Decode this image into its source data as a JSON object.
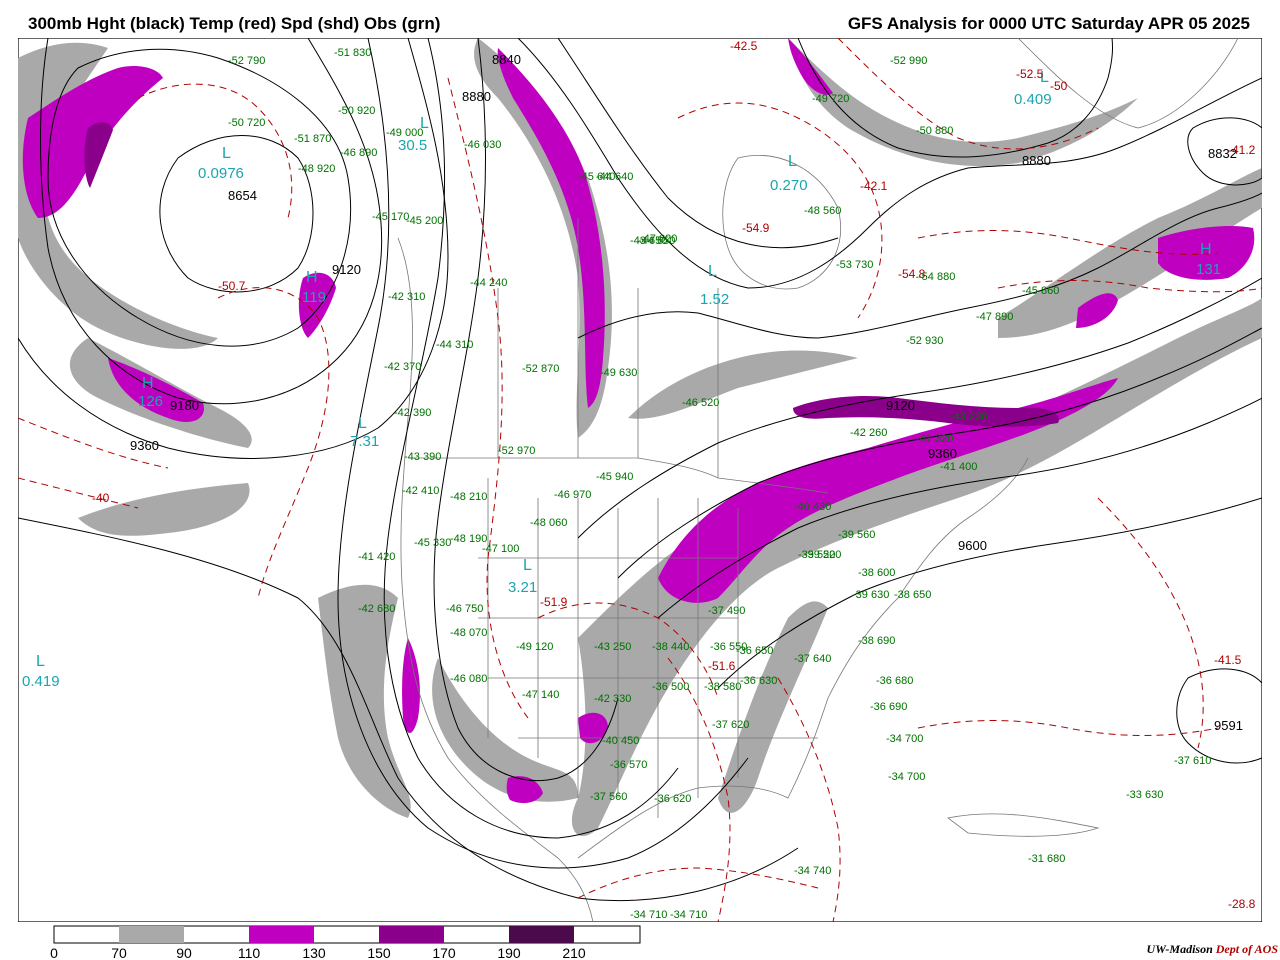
{
  "header": {
    "left_title": "300mb Hght (black) Temp (red) Spd (shd) Obs (grn)",
    "right_title": "GFS Analysis for 0000 UTC Saturday  APR 05 2025"
  },
  "colors": {
    "height_contour": "#000000",
    "temp_contour": "#b00000",
    "obs_text": "#007000",
    "label_cyan": "#1aa5b0",
    "speed_70_90": "#a9a9a9",
    "speed_110_130": "#c000c0",
    "speed_150_170": "#8b008b",
    "speed_190_210": "#4b0a4b"
  },
  "legend": {
    "ticks": [
      "0",
      "70",
      "90",
      "110",
      "130",
      "150",
      "170",
      "190",
      "210"
    ]
  },
  "credit": {
    "org": "UW-Madison",
    "dept": "Dept of AOS"
  },
  "map_labels": {
    "highs_lows": [
      {
        "text": "L",
        "kind": "low"
      },
      {
        "text": "0.0976",
        "kind": "val"
      },
      {
        "text": "L",
        "kind": "low"
      },
      {
        "text": "7.31",
        "kind": "val"
      },
      {
        "text": "L",
        "kind": "low"
      },
      {
        "text": "0.419",
        "kind": "val"
      },
      {
        "text": "L",
        "kind": "low"
      },
      {
        "text": "1.52",
        "kind": "val"
      },
      {
        "text": "L",
        "kind": "low"
      },
      {
        "text": "0.270",
        "kind": "val"
      },
      {
        "text": "L",
        "kind": "low"
      },
      {
        "text": "0.409",
        "kind": "val"
      },
      {
        "text": "L",
        "kind": "low"
      },
      {
        "text": "30.5",
        "kind": "val"
      },
      {
        "text": "L",
        "kind": "low"
      },
      {
        "text": "3.21",
        "kind": "val"
      },
      {
        "text": "H",
        "kind": "high"
      },
      {
        "text": "126",
        "kind": "val"
      },
      {
        "text": "H",
        "kind": "high"
      },
      {
        "text": "131",
        "kind": "val"
      },
      {
        "text": "H",
        "kind": "high"
      },
      {
        "text": "119",
        "kind": "val"
      }
    ],
    "heights": [
      "8654",
      "9120",
      "9180",
      "9360",
      "8880",
      "8840",
      "8880",
      "8832",
      "9600",
      "9591",
      "9360",
      "9120"
    ],
    "temps": [
      "-42.5",
      "-52.5",
      "-50",
      "-41.2",
      "-42.1",
      "-54.9",
      "-54.8",
      "-50.7",
      "-40",
      "-51.9",
      "-51.6",
      "-41.5",
      "-28.8"
    ],
    "obs": [
      "-52 790",
      "-50 720",
      "-51 830",
      "-50 920",
      "-49 000",
      "-51 870",
      "-48 920",
      "-45 170",
      "-45 200",
      "-46 890",
      "-46 030",
      "-44 310",
      "-42 310",
      "-44 240",
      "-42 370",
      "-42 390",
      "-42 410",
      "-43 390",
      "-48 210",
      "-48 190",
      "-48 060",
      "-47 100",
      "-45 330",
      "-41 420",
      "-42 680",
      "-46 750",
      "-48 070",
      "-46 080",
      "-49 120",
      "-47 140",
      "-43 250",
      "-42 330",
      "-40 450",
      "-38 440",
      "-36 500",
      "-38 580",
      "-36 630",
      "-37 640",
      "-38 690",
      "-36 690",
      "-36 680",
      "-34 700",
      "-34 700",
      "-37 610",
      "-33 630",
      "-31 680",
      "-34 740",
      "-34 710",
      "-34 710",
      "-37 620",
      "-36 650",
      "-37 560",
      "-36 570",
      "-36 620",
      "-36 550",
      "-37 490",
      "-39 520",
      "-38 600",
      "-39 630",
      "-38 650",
      "-40 430",
      "-39 520",
      "-39 560",
      "-41 400",
      "-42 260",
      "-46 520",
      "-45 940",
      "-46 970",
      "-52 870",
      "-49 630",
      "-52 970",
      "-48 560",
      "-45 640",
      "-44 650",
      "-43 650",
      "-47 620",
      "-44 640",
      "-53 730",
      "-54 880",
      "-52 930",
      "-50 880",
      "-49 720",
      "-52 990",
      "-45 860",
      "-47 890",
      "-43 230",
      "-41 320"
    ]
  }
}
